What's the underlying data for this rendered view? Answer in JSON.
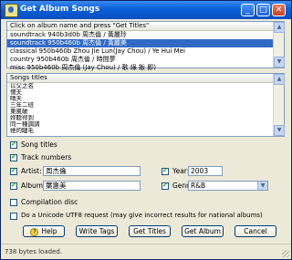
{
  "window": {
    "title": "Get Album Songs"
  },
  "title_buttons": {
    "minimize": "_",
    "maximize": "□",
    "close": "✕"
  },
  "albums": {
    "header": "Click on album name and press \"Get Titles\"",
    "items": [
      "soundtrack 940b3d0b 周杰倫 / 黃麗玲",
      "soundtrack 950b460b 周杰倫 / 黃麗美",
      "classical 950b460b Zhou Jie Lun(Jay Chou) / Ye Hui Mei",
      "country 950b460b 周杰倫 / 時間夢",
      "misc 950b460b 周杰倫 (Jay Chou) / 歌 綠 飯 即)"
    ],
    "selected_index": 1
  },
  "songs": {
    "header": "Songs titles",
    "items": [
      "以父之名",
      "懦夫",
      "晴天",
      "三年二班",
      "東風破",
      "妳聽得到",
      "同一種調調",
      "她的睫毛"
    ]
  },
  "options": {
    "song_titles": {
      "label": "Song titles",
      "checked": true
    },
    "track_numbers": {
      "label": "Track numbers",
      "checked": true
    },
    "compilation": {
      "label": "Compilation disc",
      "checked": false
    },
    "unicode": {
      "label": "Do a Unicode UTF8 request (may give incorrect results for national albums)",
      "checked": false
    }
  },
  "fields": {
    "artist": {
      "label": "Artist:",
      "value": "周杰倫",
      "checked": true
    },
    "album": {
      "label": "Album:",
      "value": "葉惠美",
      "checked": true
    },
    "year": {
      "label": "Year:",
      "value": "2003",
      "checked": true
    },
    "genre": {
      "label": "Genre:",
      "value": "R&B",
      "checked": true
    }
  },
  "buttons": {
    "help": "Help",
    "write_tags": "Write Tags",
    "get_titles": "Get Titles",
    "get_album": "Get Album",
    "cancel": "Cancel"
  },
  "status": {
    "text": "738 bytes loaded."
  }
}
